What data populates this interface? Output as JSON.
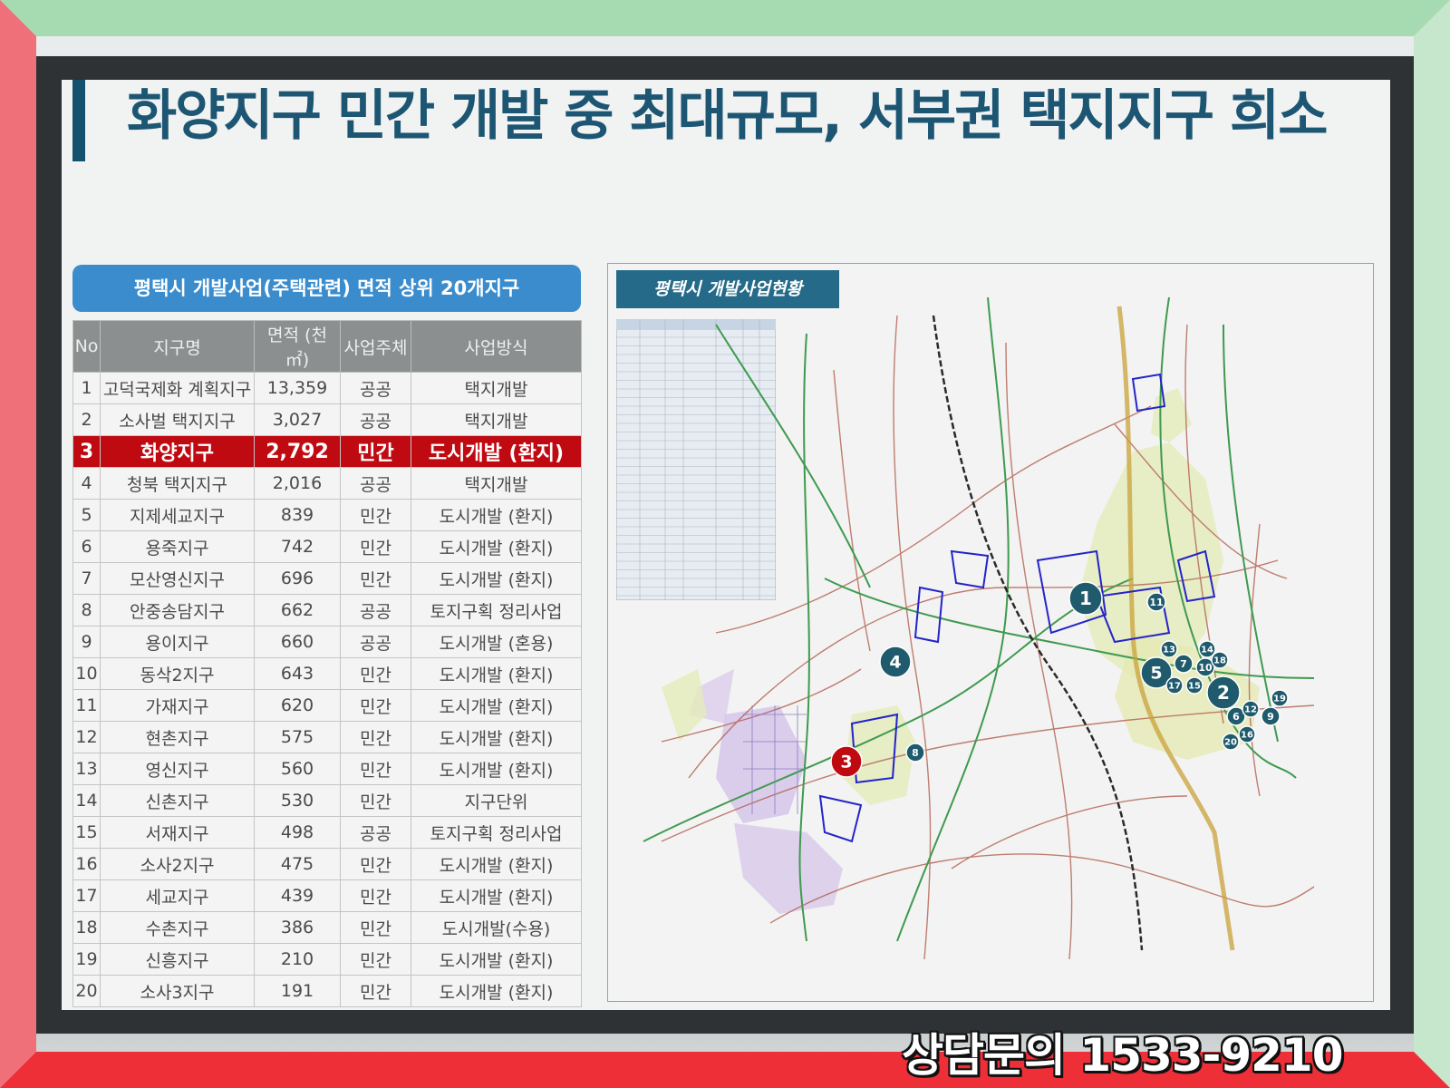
{
  "slide": {
    "title": "화양지구 민간 개발 중 최대규모, 서부권 택지지구 희소"
  },
  "table": {
    "header_title": "평택시 개발사업(주택관련) 면적 상위 20개지구",
    "columns": [
      "No",
      "지구명",
      "면적 (천㎡)",
      "사업주체",
      "사업방식"
    ],
    "rows": [
      {
        "no": "1",
        "name": "고덕국제화 계획지구",
        "area": "13,359",
        "owner": "공공",
        "method": "택지개발"
      },
      {
        "no": "2",
        "name": "소사벌 택지지구",
        "area": "3,027",
        "owner": "공공",
        "method": "택지개발"
      },
      {
        "no": "3",
        "name": "화양지구",
        "area": "2,792",
        "owner": "민간",
        "method": "도시개발 (환지)"
      },
      {
        "no": "4",
        "name": "청북 택지지구",
        "area": "2,016",
        "owner": "공공",
        "method": "택지개발"
      },
      {
        "no": "5",
        "name": "지제세교지구",
        "area": "839",
        "owner": "민간",
        "method": "도시개발 (환지)"
      },
      {
        "no": "6",
        "name": "용죽지구",
        "area": "742",
        "owner": "민간",
        "method": "도시개발 (환지)"
      },
      {
        "no": "7",
        "name": "모산영신지구",
        "area": "696",
        "owner": "민간",
        "method": "도시개발 (환지)"
      },
      {
        "no": "8",
        "name": "안중송담지구",
        "area": "662",
        "owner": "공공",
        "method": "토지구획 정리사업"
      },
      {
        "no": "9",
        "name": "용이지구",
        "area": "660",
        "owner": "공공",
        "method": "도시개발 (혼용)"
      },
      {
        "no": "10",
        "name": "동삭2지구",
        "area": "643",
        "owner": "민간",
        "method": "도시개발 (환지)"
      },
      {
        "no": "11",
        "name": "가재지구",
        "area": "620",
        "owner": "민간",
        "method": "도시개발 (환지)"
      },
      {
        "no": "12",
        "name": "현촌지구",
        "area": "575",
        "owner": "민간",
        "method": "도시개발 (환지)"
      },
      {
        "no": "13",
        "name": "영신지구",
        "area": "560",
        "owner": "민간",
        "method": "도시개발 (환지)"
      },
      {
        "no": "14",
        "name": "신촌지구",
        "area": "530",
        "owner": "민간",
        "method": "지구단위"
      },
      {
        "no": "15",
        "name": "서재지구",
        "area": "498",
        "owner": "공공",
        "method": "토지구획 정리사업"
      },
      {
        "no": "16",
        "name": "소사2지구",
        "area": "475",
        "owner": "민간",
        "method": "도시개발 (환지)"
      },
      {
        "no": "17",
        "name": "세교지구",
        "area": "439",
        "owner": "민간",
        "method": "도시개발 (환지)"
      },
      {
        "no": "18",
        "name": "수촌지구",
        "area": "386",
        "owner": "민간",
        "method": "도시개발(수용)"
      },
      {
        "no": "19",
        "name": "신흥지구",
        "area": "210",
        "owner": "민간",
        "method": "도시개발 (환지)"
      },
      {
        "no": "20",
        "name": "소사3지구",
        "area": "191",
        "owner": "민간",
        "method": "도시개발 (환지)"
      }
    ],
    "highlight_row": 3
  },
  "map": {
    "label": "평택시 개발사업현황",
    "markers": [
      {
        "label": "1",
        "color": "#1f5a6d"
      },
      {
        "label": "2",
        "color": "#1f5a6d"
      },
      {
        "label": "3",
        "color": "#c00a12"
      },
      {
        "label": "4",
        "color": "#1f5a6d"
      },
      {
        "label": "5",
        "color": "#1f5a6d"
      },
      {
        "label": "6",
        "color": "#1f5a6d"
      },
      {
        "label": "7",
        "color": "#1f5a6d"
      },
      {
        "label": "8",
        "color": "#1f5a6d"
      },
      {
        "label": "9",
        "color": "#1f5a6d"
      },
      {
        "label": "10",
        "color": "#1f5a6d"
      },
      {
        "label": "11",
        "color": "#1f5a6d"
      },
      {
        "label": "12",
        "color": "#1f5a6d"
      },
      {
        "label": "13",
        "color": "#1f5a6d"
      },
      {
        "label": "14",
        "color": "#1f5a6d"
      },
      {
        "label": "15",
        "color": "#1f5a6d"
      },
      {
        "label": "16",
        "color": "#1f5a6d"
      },
      {
        "label": "17",
        "color": "#1f5a6d"
      },
      {
        "label": "18",
        "color": "#1f5a6d"
      },
      {
        "label": "19",
        "color": "#1f5a6d"
      },
      {
        "label": "20",
        "color": "#1f5a6d"
      }
    ]
  },
  "contact": {
    "text": "상담문의 1533-9210"
  },
  "colors": {
    "title": "#1d5673",
    "highlight_row": "#c00a12",
    "table_header": "#3a8ccd",
    "map_label": "#256a89"
  }
}
